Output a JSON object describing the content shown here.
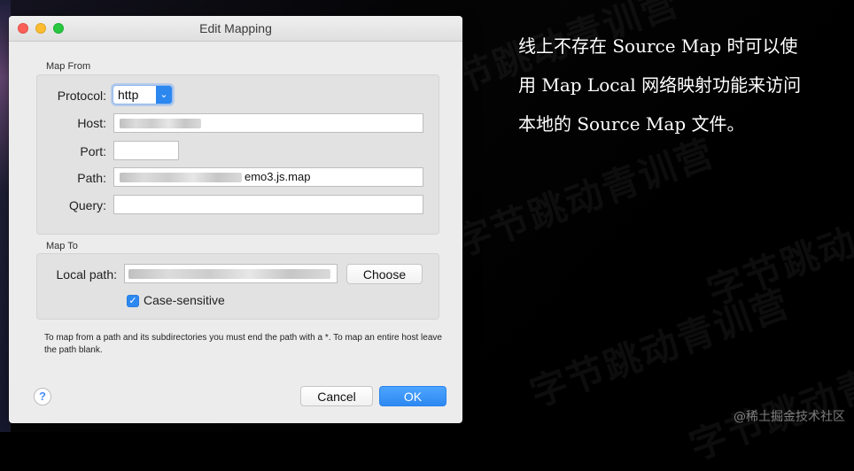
{
  "background": {
    "watermark": "字节跳动青训营"
  },
  "window": {
    "title": "Edit Mapping"
  },
  "sections": {
    "map_from": "Map From",
    "map_to": "Map To"
  },
  "form": {
    "protocol_label": "Protocol:",
    "protocol_value": "http",
    "host_label": "Host:",
    "port_label": "Port:",
    "path_label": "Path:",
    "path_value": "emo3.js.map",
    "query_label": "Query:",
    "local_path_label": "Local path:",
    "choose_label": "Choose",
    "case_sensitive_label": "Case-sensitive"
  },
  "help": {
    "text": "To map from a path and its subdirectories you must end the path with a *. To map an entire host leave the path blank.",
    "button_label": "?"
  },
  "footer": {
    "cancel_label": "Cancel",
    "ok_label": "OK"
  },
  "side_text": "线上不存在 Source Map 时可以使用 Map Local 网络映射功能来访问本地的 Source Map 文件。",
  "credit": "@稀土掘金技术社区",
  "colors": {
    "accent": "#2d88f1",
    "dialog_bg": "#ececec",
    "page_bg": "#000000"
  }
}
